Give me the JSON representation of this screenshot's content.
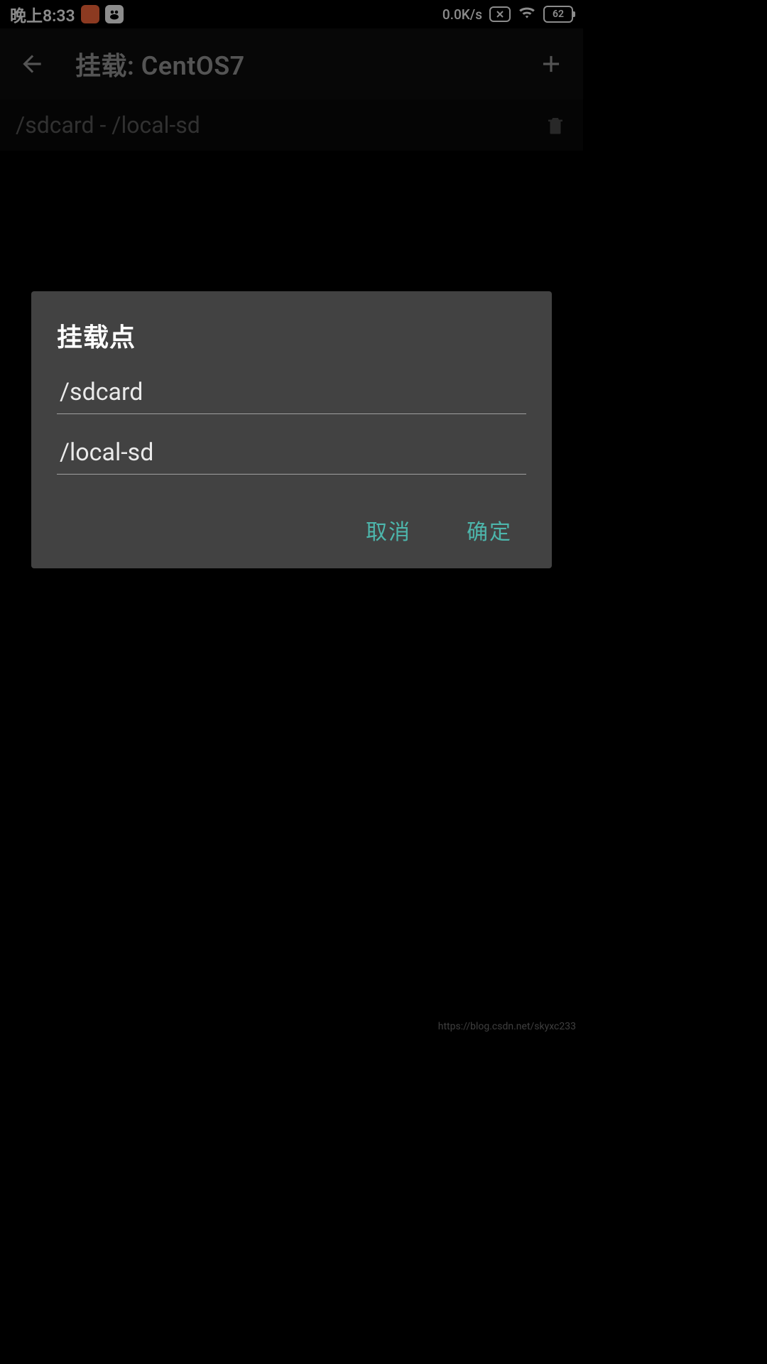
{
  "status_bar": {
    "time": "晚上8:33",
    "net_speed": "0.0K/s",
    "battery": "62"
  },
  "app_bar": {
    "title": "挂载: CentOS7"
  },
  "list": {
    "items": [
      {
        "label": "/sdcard - /local-sd"
      }
    ]
  },
  "dialog": {
    "title": "挂载点",
    "field1_value": "/sdcard",
    "field2_value": "/local-sd",
    "cancel_label": "取消",
    "confirm_label": "确定"
  },
  "watermark": "https://blog.csdn.net/skyxc233"
}
